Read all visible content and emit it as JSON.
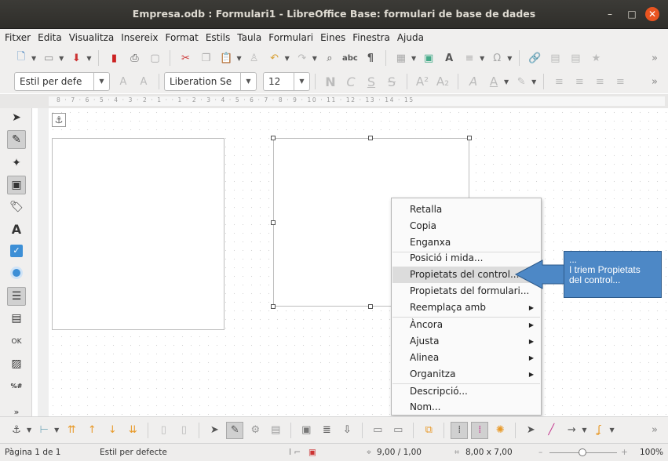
{
  "window": {
    "title": "Empresa.odb : Formulari1 - LibreOffice Base: formulari de base de dades"
  },
  "menubar": {
    "items": [
      "Fitxer",
      "Edita",
      "Visualitza",
      "Insereix",
      "Format",
      "Estils",
      "Taula",
      "Formulari",
      "Eines",
      "Finestra",
      "Ajuda"
    ]
  },
  "formatting": {
    "paragraph_style": "Estil per defe",
    "font_name": "Liberation Se",
    "font_size": "12"
  },
  "ruler": {
    "ticks": "8 · 7 · 6 · 5 · 4 · 3 · 2 · 1 ·   · 1 · 2 · 3 · 4 · 5 · 6 · 7 · 8 · 9 · 10 · 11 · 12 · 13 · 14 · 15"
  },
  "context_menu": {
    "items": [
      {
        "label": "Retalla"
      },
      {
        "label": "Copia"
      },
      {
        "label": "Enganxa"
      },
      {
        "label": "Posició i mida..."
      },
      {
        "label": "Propietats del control..."
      },
      {
        "label": "Propietats del formulari..."
      },
      {
        "label": "Reemplaça amb"
      },
      {
        "label": "Àncora"
      },
      {
        "label": "Ajusta"
      },
      {
        "label": "Alinea"
      },
      {
        "label": "Organitza"
      },
      {
        "label": "Descripció..."
      },
      {
        "label": "Nom..."
      }
    ],
    "highlighted": "Propietats del control..."
  },
  "callout": {
    "text_dots": "...",
    "text_line1": "I triem Propietats",
    "text_line2": "del control..."
  },
  "statusbar": {
    "page": "Pàgina 1 de 1",
    "style": "Estil per defecte",
    "position": "9,00 / 1,00",
    "size": "8,00 x 7,00",
    "zoom": "100%"
  },
  "colors": {
    "accent_close": "#e95420",
    "callout_fill": "#4d88c6",
    "highlight": "#dcdcdc"
  }
}
